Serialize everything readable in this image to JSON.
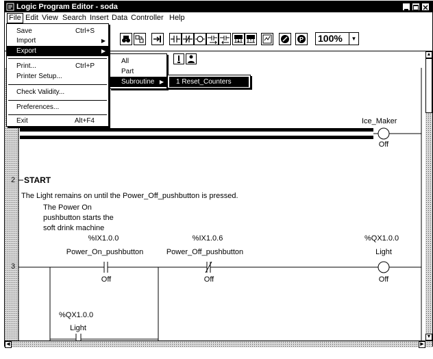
{
  "window": {
    "title": "Logic Program Editor - soda"
  },
  "menubar": [
    "File",
    "Edit",
    "View",
    "Search",
    "Insert",
    "Data",
    "Controller",
    "Help"
  ],
  "toolbar": {
    "zoom": "100%"
  },
  "file_menu": {
    "items": [
      {
        "label": "Save",
        "shortcut": "Ctrl+S"
      },
      {
        "label": "Import",
        "shortcut": ""
      },
      {
        "label": "Export",
        "shortcut": ""
      },
      {
        "label": "Print...",
        "shortcut": "Ctrl+P"
      },
      {
        "label": "Printer Setup...",
        "shortcut": ""
      },
      {
        "label": "Check Validity...",
        "shortcut": ""
      },
      {
        "label": "Preferences...",
        "shortcut": ""
      },
      {
        "label": "Exit",
        "shortcut": "Alt+F4"
      }
    ]
  },
  "export_menu": {
    "items": [
      "All",
      "Part",
      "Subroutine"
    ]
  },
  "subroutine_menu": {
    "items": [
      "1 Reset_Counters"
    ]
  },
  "ladder": {
    "rung1": {
      "coil_name": "Ice_Maker",
      "coil_state": "Off"
    },
    "rung2": {
      "number": "2",
      "title": "START",
      "comment": "The Light remains on until the Power_Off_pushbutton is pressed.",
      "note_lines": [
        "The Power On",
        "pushbutton starts the",
        "soft drink machine"
      ]
    },
    "rung3": {
      "number": "3",
      "contact1": {
        "address": "%IX1.0.0",
        "name": "Power_On_pushbutton",
        "state": "Off"
      },
      "contact2": {
        "address": "%IX1.0.6",
        "name": "Power_Off_pushbutton",
        "state": "Off"
      },
      "coil": {
        "address": "%QX1.0.0",
        "name": "Light",
        "state": "Off"
      },
      "branch": {
        "address": "%QX1.0.0",
        "name": "Light"
      }
    }
  }
}
